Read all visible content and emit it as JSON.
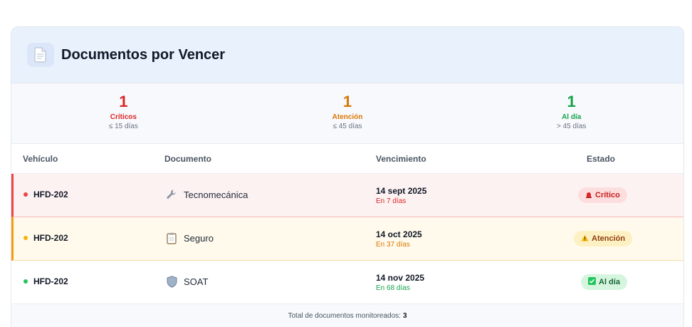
{
  "header": {
    "title": "Documentos por Vencer",
    "icon": "document-icon"
  },
  "summary": [
    {
      "count": "1",
      "label": "Críticos",
      "sub": "≤ 15 días",
      "color": "#dc2626"
    },
    {
      "count": "1",
      "label": "Atención",
      "sub": "≤ 45 días",
      "color": "#d97706"
    },
    {
      "count": "1",
      "label": "Al día",
      "sub": "> 45 días",
      "color": "#16a34a"
    }
  ],
  "table": {
    "columns": [
      "Vehículo",
      "Documento",
      "Vencimiento",
      "Estado"
    ],
    "rows": [
      {
        "vehicle": "HFD-202",
        "document": "Tecnomecánica",
        "doc_icon": "wrench-icon",
        "date": "14 sept 2025",
        "relative": "En 7 días",
        "status": "Crítico",
        "status_icon": "siren-icon",
        "status_color": "#c81e1e"
      },
      {
        "vehicle": "HFD-202",
        "document": "Seguro",
        "doc_icon": "clipboard-icon",
        "date": "14 oct 2025",
        "relative": "En 37 días",
        "status": "Atención",
        "status_icon": "warning-icon",
        "status_color": "#92400e"
      },
      {
        "vehicle": "HFD-202",
        "document": "SOAT",
        "doc_icon": "shield-icon",
        "date": "14 nov 2025",
        "relative": "En 68 días",
        "status": "Al día",
        "status_icon": "check-icon",
        "status_color": "#166534"
      }
    ]
  },
  "footer": {
    "label": "Total de documentos monitoreados:",
    "total": "3"
  }
}
